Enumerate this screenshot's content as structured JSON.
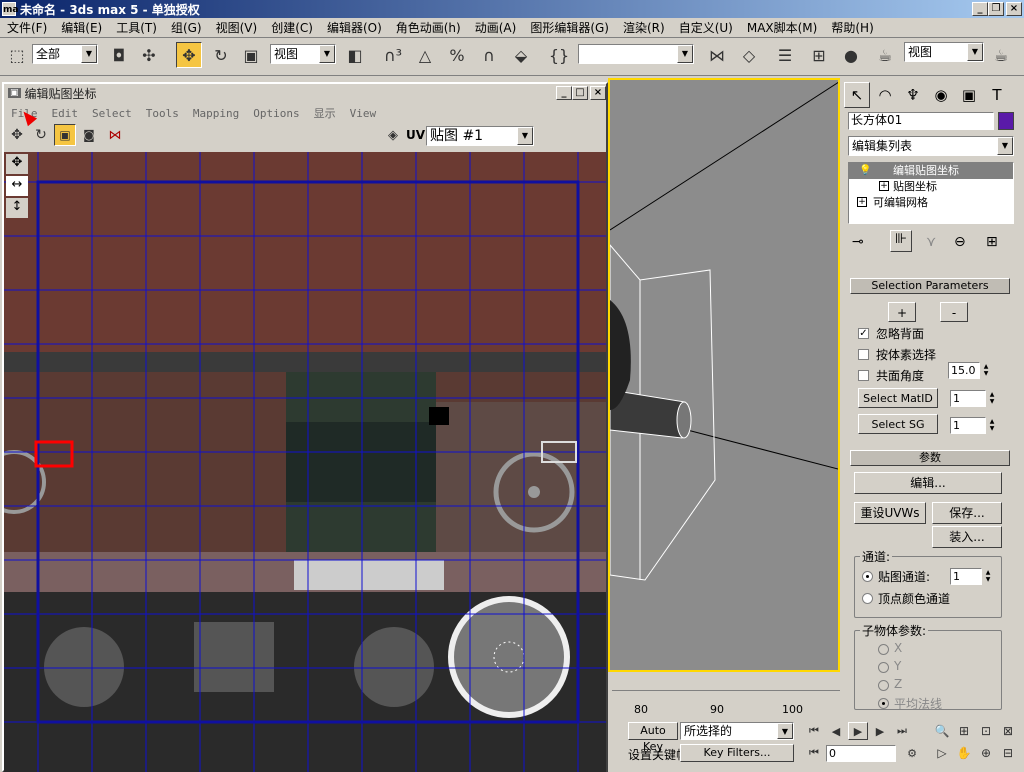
{
  "titlebar": {
    "title": "未命名 - 3ds max 5 - 单独授权",
    "icon_text": "ma"
  },
  "menubar": [
    "文件(F)",
    "编辑(E)",
    "工具(T)",
    "组(G)",
    "视图(V)",
    "创建(C)",
    "编辑器(O)",
    "角色动画(h)",
    "动画(A)",
    "图形编辑器(G)",
    "渲染(R)",
    "自定义(U)",
    "MAX脚本(M)",
    "帮助(H)"
  ],
  "toolbar": {
    "selection_filter": "全部",
    "ref_coord": "视图",
    "named_selection": "",
    "render_view": "视图"
  },
  "uv_editor": {
    "title": "编辑贴图坐标",
    "menu": [
      "File",
      "Edit",
      "Select",
      "Tools",
      "Mapping",
      "Options",
      "显示",
      "View"
    ],
    "uv_label": "UV",
    "map_select": "贴图 #1"
  },
  "cmd": {
    "object_name": "长方体01",
    "modifier_list": "编辑集列表",
    "stack": [
      "编辑贴图坐标",
      "贴图坐标",
      "可编辑网格"
    ],
    "selection_rollout": "Selection Parameters",
    "plus": "+",
    "minus": "-",
    "ignore_backface": "忽略背面",
    "select_by_element": "按体素选择",
    "planar_angle": "共面角度",
    "planar_value": "15.0",
    "select_matid": "Select MatID",
    "matid_value": "1",
    "select_sg": "Select SG",
    "sg_value": "1",
    "params_rollout": "参数",
    "edit_btn": "编辑...",
    "reset_uvws": "重设UVWs",
    "save_btn": "保存...",
    "load_btn": "装入...",
    "channel_group": "通道:",
    "map_channel": "贴图通道:",
    "map_channel_value": "1",
    "vertex_color": "顶点颜色通道",
    "sub_params": "子物体参数:",
    "axes": [
      "X",
      "Y",
      "Z",
      "平均法线"
    ]
  },
  "timeline": {
    "ticks": [
      "80",
      "90",
      "100"
    ]
  },
  "bottom": {
    "auto_key": "Auto Key",
    "set_key_filter": "所选择的",
    "set_key": "设置关键帧",
    "key_filters": "Key Filters...",
    "frame": "0"
  }
}
